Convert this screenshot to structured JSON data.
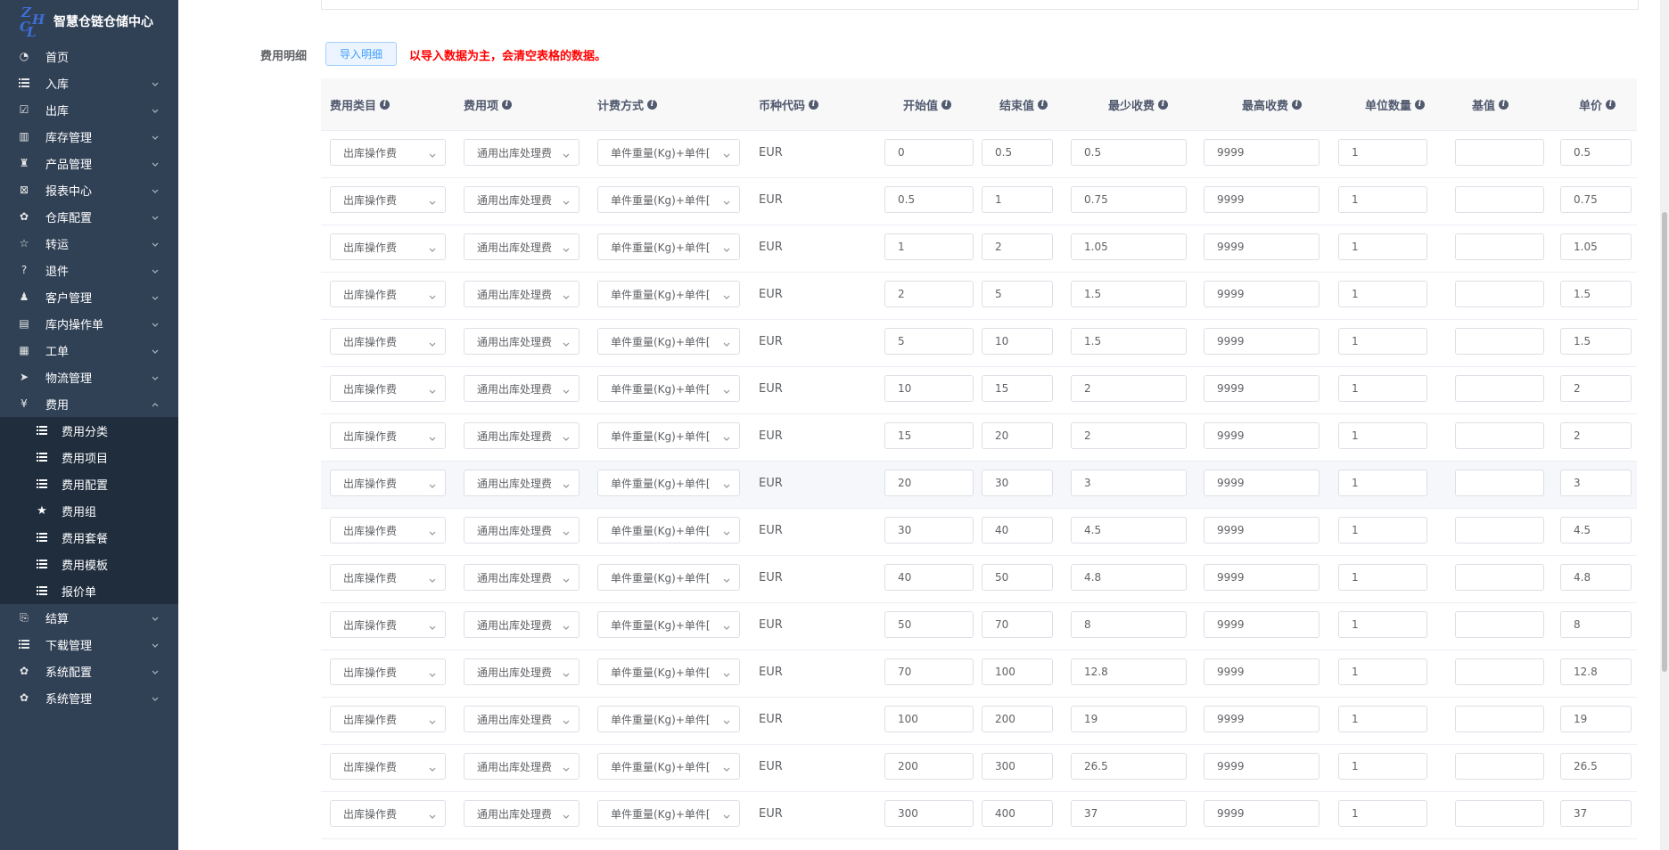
{
  "app": {
    "title": "智慧仓链仓储中心",
    "logo_letters": [
      "Z",
      "H",
      "C",
      "L"
    ]
  },
  "sidebar": {
    "items": [
      {
        "label": "首页",
        "icon": "dashboard-icon",
        "arrow": false
      },
      {
        "label": "入库",
        "icon": "list-icon",
        "arrow": true
      },
      {
        "label": "出库",
        "icon": "checkbox-icon",
        "arrow": true
      },
      {
        "label": "库存管理",
        "icon": "inventory-icon",
        "arrow": true
      },
      {
        "label": "产品管理",
        "icon": "shirt-icon",
        "arrow": true
      },
      {
        "label": "报表中心",
        "icon": "report-icon",
        "arrow": true
      },
      {
        "label": "仓库配置",
        "icon": "gear-icon",
        "arrow": true
      },
      {
        "label": "转运",
        "icon": "star-outline-icon",
        "arrow": true
      },
      {
        "label": "退件",
        "icon": "question-circle-icon",
        "arrow": true
      },
      {
        "label": "客户管理",
        "icon": "people-icon",
        "arrow": true
      },
      {
        "label": "库内操作单",
        "icon": "document-icon",
        "arrow": true
      },
      {
        "label": "工单",
        "icon": "table-icon",
        "arrow": true
      },
      {
        "label": "物流管理",
        "icon": "send-icon",
        "arrow": true
      },
      {
        "label": "费用",
        "icon": "yen-icon",
        "arrow": true,
        "expanded": true
      }
    ],
    "fee_sub": [
      {
        "label": "费用分类",
        "icon": "list-icon"
      },
      {
        "label": "费用项目",
        "icon": "list-icon"
      },
      {
        "label": "费用配置",
        "icon": "list-icon"
      },
      {
        "label": "费用组",
        "icon": "star-icon"
      },
      {
        "label": "费用套餐",
        "icon": "list-icon"
      },
      {
        "label": "费用模板",
        "icon": "list-icon"
      },
      {
        "label": "报价单",
        "icon": "list-icon"
      }
    ],
    "items_after": [
      {
        "label": "结算",
        "icon": "settle-icon",
        "arrow": true
      },
      {
        "label": "下载管理",
        "icon": "list-icon",
        "arrow": true
      },
      {
        "label": "系统配置",
        "icon": "gear-icon",
        "arrow": true
      },
      {
        "label": "系统管理",
        "icon": "gear-icon",
        "arrow": true
      }
    ]
  },
  "fee_detail": {
    "label": "费用明细",
    "import_button": "导入明细",
    "warning": "以导入数据为主，会清空表格的数据。"
  },
  "table": {
    "columns": [
      "费用类目",
      "费用项",
      "计费方式",
      "币种代码",
      "开始值",
      "结束值",
      "最少收费",
      "最高收费",
      "单位数量",
      "基值",
      "单价"
    ],
    "rows": [
      {
        "category": "出库操作费",
        "item": "通用出库处理费",
        "method": "单件重量(Kg)+单件[",
        "currency": "EUR",
        "start": "0",
        "end": "0.5",
        "min": "0.5",
        "max": "9999",
        "unit": "1",
        "base": "",
        "price": "0.5"
      },
      {
        "category": "出库操作费",
        "item": "通用出库处理费",
        "method": "单件重量(Kg)+单件[",
        "currency": "EUR",
        "start": "0.5",
        "end": "1",
        "min": "0.75",
        "max": "9999",
        "unit": "1",
        "base": "",
        "price": "0.75"
      },
      {
        "category": "出库操作费",
        "item": "通用出库处理费",
        "method": "单件重量(Kg)+单件[",
        "currency": "EUR",
        "start": "1",
        "end": "2",
        "min": "1.05",
        "max": "9999",
        "unit": "1",
        "base": "",
        "price": "1.05"
      },
      {
        "category": "出库操作费",
        "item": "通用出库处理费",
        "method": "单件重量(Kg)+单件[",
        "currency": "EUR",
        "start": "2",
        "end": "5",
        "min": "1.5",
        "max": "9999",
        "unit": "1",
        "base": "",
        "price": "1.5"
      },
      {
        "category": "出库操作费",
        "item": "通用出库处理费",
        "method": "单件重量(Kg)+单件[",
        "currency": "EUR",
        "start": "5",
        "end": "10",
        "min": "1.5",
        "max": "9999",
        "unit": "1",
        "base": "",
        "price": "1.5"
      },
      {
        "category": "出库操作费",
        "item": "通用出库处理费",
        "method": "单件重量(Kg)+单件[",
        "currency": "EUR",
        "start": "10",
        "end": "15",
        "min": "2",
        "max": "9999",
        "unit": "1",
        "base": "",
        "price": "2"
      },
      {
        "category": "出库操作费",
        "item": "通用出库处理费",
        "method": "单件重量(Kg)+单件[",
        "currency": "EUR",
        "start": "15",
        "end": "20",
        "min": "2",
        "max": "9999",
        "unit": "1",
        "base": "",
        "price": "2"
      },
      {
        "category": "出库操作费",
        "item": "通用出库处理费",
        "method": "单件重量(Kg)+单件[",
        "currency": "EUR",
        "start": "20",
        "end": "30",
        "min": "3",
        "max": "9999",
        "unit": "1",
        "base": "",
        "price": "3",
        "highlight": true
      },
      {
        "category": "出库操作费",
        "item": "通用出库处理费",
        "method": "单件重量(Kg)+单件[",
        "currency": "EUR",
        "start": "30",
        "end": "40",
        "min": "4.5",
        "max": "9999",
        "unit": "1",
        "base": "",
        "price": "4.5"
      },
      {
        "category": "出库操作费",
        "item": "通用出库处理费",
        "method": "单件重量(Kg)+单件[",
        "currency": "EUR",
        "start": "40",
        "end": "50",
        "min": "4.8",
        "max": "9999",
        "unit": "1",
        "base": "",
        "price": "4.8"
      },
      {
        "category": "出库操作费",
        "item": "通用出库处理费",
        "method": "单件重量(Kg)+单件[",
        "currency": "EUR",
        "start": "50",
        "end": "70",
        "min": "8",
        "max": "9999",
        "unit": "1",
        "base": "",
        "price": "8"
      },
      {
        "category": "出库操作费",
        "item": "通用出库处理费",
        "method": "单件重量(Kg)+单件[",
        "currency": "EUR",
        "start": "70",
        "end": "100",
        "min": "12.8",
        "max": "9999",
        "unit": "1",
        "base": "",
        "price": "12.8"
      },
      {
        "category": "出库操作费",
        "item": "通用出库处理费",
        "method": "单件重量(Kg)+单件[",
        "currency": "EUR",
        "start": "100",
        "end": "200",
        "min": "19",
        "max": "9999",
        "unit": "1",
        "base": "",
        "price": "19"
      },
      {
        "category": "出库操作费",
        "item": "通用出库处理费",
        "method": "单件重量(Kg)+单件[",
        "currency": "EUR",
        "start": "200",
        "end": "300",
        "min": "26.5",
        "max": "9999",
        "unit": "1",
        "base": "",
        "price": "26.5"
      },
      {
        "category": "出库操作费",
        "item": "通用出库处理费",
        "method": "单件重量(Kg)+单件[",
        "currency": "EUR",
        "start": "300",
        "end": "400",
        "min": "37",
        "max": "9999",
        "unit": "1",
        "base": "",
        "price": "37"
      }
    ]
  },
  "colors": {
    "sidebar_bg": "#304156",
    "submenu_bg": "#1f2d3d",
    "warning": "#ff0000",
    "primary": "#409eff"
  }
}
